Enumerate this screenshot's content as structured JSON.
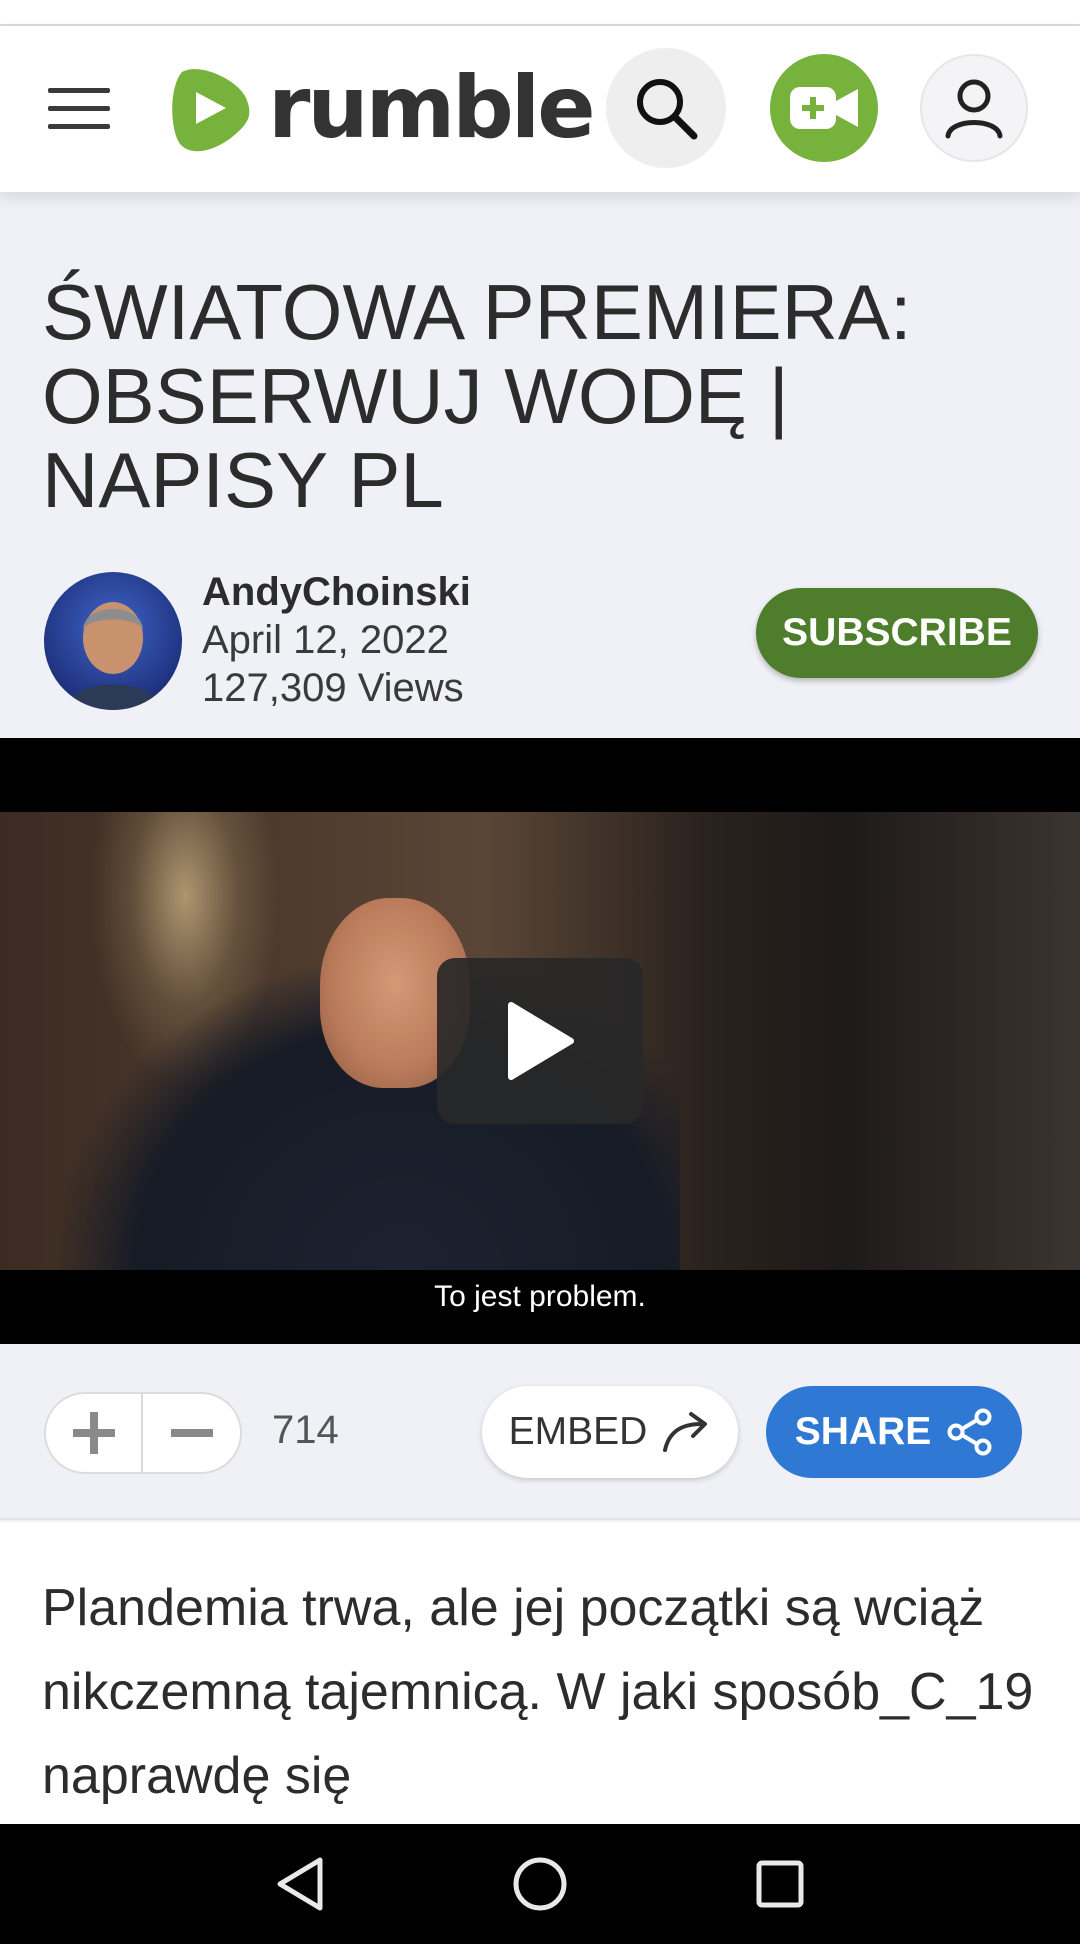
{
  "header": {
    "logo_text": "rumble",
    "menu_icon": "hamburger-menu-icon",
    "search_icon": "search-icon",
    "upload_icon": "video-camera-plus-icon",
    "account_icon": "user-icon",
    "brand_color": "#77b23c"
  },
  "video": {
    "title": "ŚWIATOWA PREMIERA: OBSERWUJ WODĘ | NAPISY PL",
    "channel": "AndyChoinski",
    "date": "April 12, 2022",
    "views": "127,309 Views",
    "subscribe_label": "SUBSCRIBE",
    "subscribe_color": "#4e7d2b",
    "player": {
      "subtitle": "To jest problem.",
      "play_icon": "play-icon"
    }
  },
  "actions": {
    "upvote_icon": "plus-icon",
    "downvote_icon": "minus-icon",
    "vote_count": "714",
    "embed_label": "EMBED",
    "embed_icon": "share-arrow-icon",
    "share_label": "SHARE",
    "share_icon": "share-nodes-icon",
    "share_color": "#2f78d3"
  },
  "description": {
    "text": "Plandemia trwa, ale jej początki są wciąż nikczemną tajemnicą. W jaki sposób_C_19 naprawdę się"
  },
  "system_nav": {
    "back_icon": "back-triangle-icon",
    "home_icon": "home-circle-icon",
    "recents_icon": "recents-square-icon"
  }
}
